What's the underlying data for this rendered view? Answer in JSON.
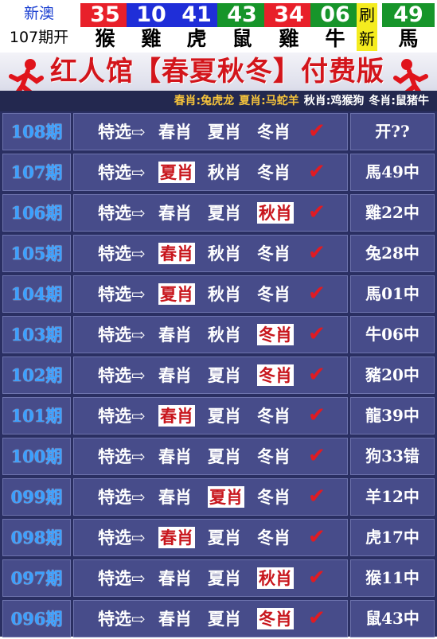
{
  "draw": {
    "region": "新澳",
    "period": "107期开",
    "balls": [
      {
        "num": "35",
        "zodiac": "猴",
        "color": "red"
      },
      {
        "num": "10",
        "zodiac": "雞",
        "color": "blue"
      },
      {
        "num": "41",
        "zodiac": "虎",
        "color": "blue"
      },
      {
        "num": "43",
        "zodiac": "鼠",
        "color": "green"
      },
      {
        "num": "34",
        "zodiac": "雞",
        "color": "red"
      },
      {
        "num": "06",
        "zodiac": "牛",
        "color": "green"
      }
    ],
    "refresh_label": "刷新",
    "special": {
      "num": "49",
      "zodiac": "馬",
      "color": "green"
    }
  },
  "banner": {
    "title": "红人馆【春夏秋冬】付费版",
    "legend": [
      "春肖:兔虎龙",
      "夏肖:马蛇羊",
      "秋肖:鸡猴狗",
      "冬肖:鼠猪牛"
    ]
  },
  "table": {
    "rows": [
      {
        "period": "108期",
        "label": "特选⇨",
        "picks": [
          "春肖",
          "夏肖",
          "冬肖"
        ],
        "hit_index": -1,
        "check": "✔",
        "result": "开??"
      },
      {
        "period": "107期",
        "label": "特选⇨",
        "picks": [
          "夏肖",
          "秋肖",
          "冬肖"
        ],
        "hit_index": 0,
        "check": "✔",
        "result": "馬49中"
      },
      {
        "period": "106期",
        "label": "特选⇨",
        "picks": [
          "春肖",
          "夏肖",
          "秋肖"
        ],
        "hit_index": 2,
        "check": "✔",
        "result": "雞22中"
      },
      {
        "period": "105期",
        "label": "特选⇨",
        "picks": [
          "春肖",
          "秋肖",
          "冬肖"
        ],
        "hit_index": 0,
        "check": "✔",
        "result": "兔28中"
      },
      {
        "period": "104期",
        "label": "特选⇨",
        "picks": [
          "夏肖",
          "秋肖",
          "冬肖"
        ],
        "hit_index": 0,
        "check": "✔",
        "result": "馬01中"
      },
      {
        "period": "103期",
        "label": "特选⇨",
        "picks": [
          "春肖",
          "秋肖",
          "冬肖"
        ],
        "hit_index": 2,
        "check": "✔",
        "result": "牛06中"
      },
      {
        "period": "102期",
        "label": "特选⇨",
        "picks": [
          "春肖",
          "夏肖",
          "冬肖"
        ],
        "hit_index": 2,
        "check": "✔",
        "result": "豬20中"
      },
      {
        "period": "101期",
        "label": "特选⇨",
        "picks": [
          "春肖",
          "夏肖",
          "冬肖"
        ],
        "hit_index": 0,
        "check": "✔",
        "result": "龍39中"
      },
      {
        "period": "100期",
        "label": "特选⇨",
        "picks": [
          "春肖",
          "夏肖",
          "冬肖"
        ],
        "hit_index": -1,
        "check": "✔",
        "result": "狗33错"
      },
      {
        "period": "099期",
        "label": "特选⇨",
        "picks": [
          "春肖",
          "夏肖",
          "冬肖"
        ],
        "hit_index": 1,
        "check": "✔",
        "result": "羊12中"
      },
      {
        "period": "098期",
        "label": "特选⇨",
        "picks": [
          "春肖",
          "夏肖",
          "冬肖"
        ],
        "hit_index": 0,
        "check": "✔",
        "result": "虎17中"
      },
      {
        "period": "097期",
        "label": "特选⇨",
        "picks": [
          "春肖",
          "夏肖",
          "秋肖"
        ],
        "hit_index": 2,
        "check": "✔",
        "result": "猴11中"
      },
      {
        "period": "096期",
        "label": "特选⇨",
        "picks": [
          "春肖",
          "夏肖",
          "冬肖"
        ],
        "hit_index": 2,
        "check": "✔",
        "result": "鼠43中"
      }
    ]
  },
  "colors": {
    "red_ball": "#e8202a",
    "blue_ball": "#1f2ed8",
    "green_ball": "#17952a",
    "table_bg": "#2a2f62",
    "cell_bg": "#474c8a",
    "period_text": "#3aa0ff",
    "hit_text": "#c8161d",
    "check": "#e11b22"
  },
  "icons": {
    "runner": "running-man-icon",
    "check": "check-mark-icon",
    "arrow": "arrow-right-icon"
  }
}
